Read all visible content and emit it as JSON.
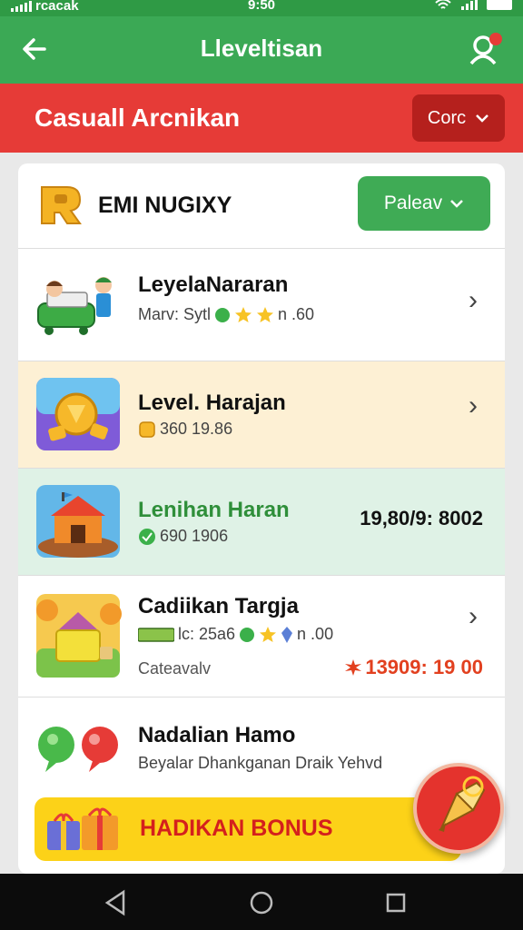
{
  "status_bar": {
    "carrier": "rcacak",
    "time": "9:50"
  },
  "app_bar": {
    "title": "Lleveltisan",
    "back_icon": "arrow-left-icon",
    "profile_icon": "profile-notification-icon"
  },
  "category_bar": {
    "title": "Casuall Arcnikan",
    "dropdown_label": "Corc"
  },
  "card": {
    "header": {
      "name": "EMI NUGIXY",
      "button_label": "Paleav"
    },
    "rows": [
      {
        "title": "LeyelaNararan",
        "subtitle": "Marv: Sytl",
        "meta": "n .60"
      },
      {
        "title": "Level. Harajan",
        "subtitle": "360 19.86"
      },
      {
        "title": "Lenihan Haran",
        "subtitle": "690 1906",
        "value": "19,80/9: 8002"
      },
      {
        "title": "Cadiikan Targja",
        "subtitle": "lc: 25a6",
        "meta": "n .00",
        "extra_label": "Cateavalv",
        "value": "13909: 19 00"
      },
      {
        "title": "Nadalian Hamo",
        "subtitle": "Beyalar Dhankganan Draik Yehvd"
      }
    ],
    "bonus_label": "HADIKAN BONUS"
  },
  "colors": {
    "app_bar": "#3ba955",
    "category_bar": "#e63b37",
    "green_button": "#3fab55",
    "bonus_bg": "#fcd218",
    "bonus_text": "#d4201d",
    "row_highlight_yellow": "#fdf0d4",
    "row_highlight_green": "#dff2e6"
  }
}
